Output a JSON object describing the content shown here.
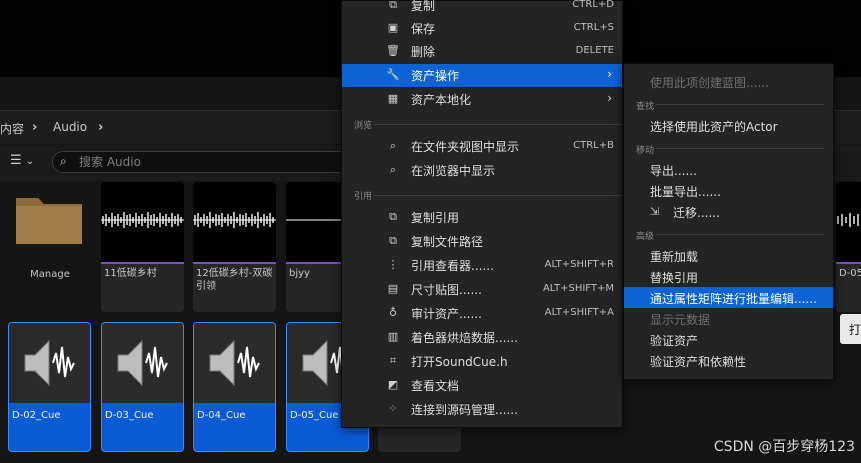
{
  "breadcrumb": {
    "items": [
      "内容",
      "Audio"
    ]
  },
  "filter": {
    "icon": "filter-icon"
  },
  "search": {
    "placeholder": "搜索 Audio",
    "value": ""
  },
  "assets": {
    "row1": [
      {
        "label": "Manage",
        "kind": "folder"
      },
      {
        "label": "11低碳乡村",
        "kind": "sound"
      },
      {
        "label": "12低碳乡村-双碳引领",
        "kind": "sound"
      },
      {
        "label": "bjyy",
        "kind": "sound"
      }
    ],
    "row2": [
      {
        "label": "D-02_Cue"
      },
      {
        "label": "D-03_Cue"
      },
      {
        "label": "D-04_Cue"
      },
      {
        "label": "D-05_Cue"
      }
    ],
    "right_partial_label": "D-05"
  },
  "context_menu": {
    "items_top": [
      {
        "label": "复制",
        "shortcut": "CTRL+D",
        "icon": "copy-icon"
      },
      {
        "label": "保存",
        "shortcut": "CTRL+S",
        "icon": "save-icon"
      },
      {
        "label": "删除",
        "shortcut": "DELETE",
        "icon": "trash-icon"
      },
      {
        "label": "资产操作",
        "icon": "wrench-icon"
      },
      {
        "label": "资产本地化",
        "icon": "localize-icon"
      }
    ],
    "section_browse": "浏览",
    "items_browse": [
      {
        "label": "在文件夹视图中显示",
        "shortcut": "CTRL+B",
        "icon": "folder-search-icon"
      },
      {
        "label": "在浏览器中显示",
        "icon": "browser-search-icon"
      }
    ],
    "section_ref": "引用",
    "items_ref": [
      {
        "label": "复制引用",
        "icon": "copy-ref-icon"
      },
      {
        "label": "复制文件路径",
        "icon": "copy-path-icon"
      },
      {
        "label": "引用查看器......",
        "shortcut": "ALT+SHIFT+R",
        "icon": "reference-viewer-icon"
      },
      {
        "label": "尺寸贴图......",
        "shortcut": "ALT+SHIFT+M",
        "icon": "size-map-icon"
      },
      {
        "label": "审计资产......",
        "shortcut": "ALT+SHIFT+A",
        "icon": "audit-icon"
      },
      {
        "label": "着色器烘焙数据......",
        "icon": "shader-icon"
      },
      {
        "label": "打开SoundCue.h",
        "icon": "code-icon"
      },
      {
        "label": "查看文档",
        "icon": "book-icon"
      },
      {
        "label": "连接到源码管理......",
        "icon": "source-control-icon"
      }
    ]
  },
  "submenu": {
    "create_bp": "使用此项创建蓝图......",
    "section_find": "查找",
    "select_actor": "选择使用此资产的Actor",
    "section_move": "移动",
    "export": "导出......",
    "bulk_export": "批量导出......",
    "migrate": "迁移......",
    "section_advanced": "高级",
    "reload": "重新加载",
    "replace_refs": "替换引用",
    "bulk_edit": "通过属性矩阵进行批量编辑......",
    "show_metadata": "显示元数据",
    "validate": "验证资产",
    "validate_deps": "验证资产和依赖性"
  },
  "partial_button": "打",
  "watermark": "CSDN @百步穿杨123",
  "colors": {
    "accent": "#0b63d6",
    "sound_bar": "#7b4fc9",
    "selected_tile": "#0b5bd6"
  }
}
